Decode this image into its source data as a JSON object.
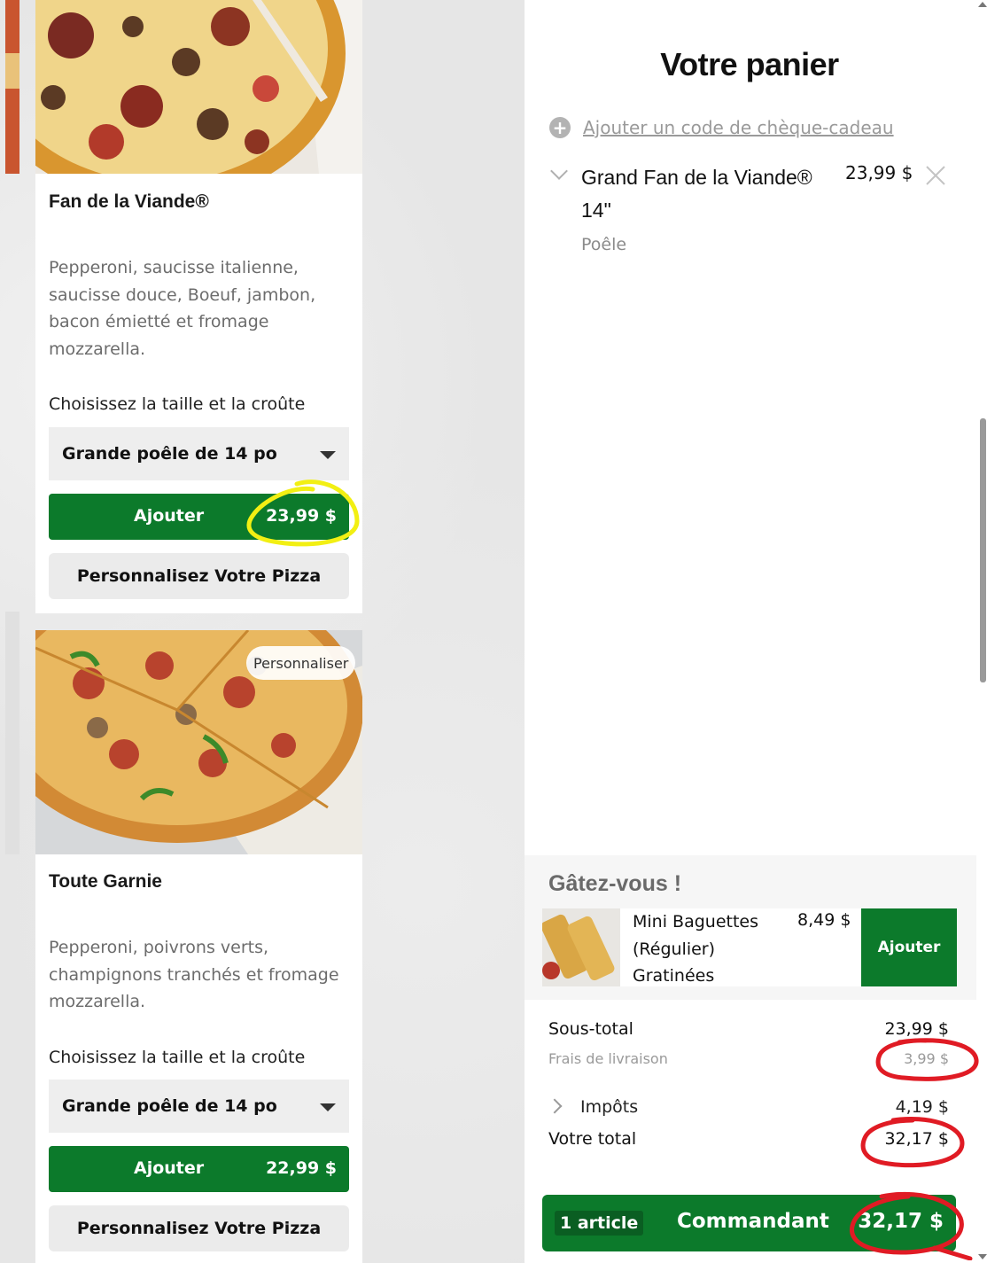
{
  "colors": {
    "brand_green": "#0c7a2b",
    "annotation_yellow": "#f2ef13",
    "annotation_red": "#e01b24"
  },
  "menu": {
    "cards": [
      {
        "title": "Fan de la Viande®",
        "description": "Pepperoni, saucisse italienne, saucisse douce, Boeuf, jambon, bacon émietté et fromage mozzarella.",
        "choose_label": "Choisissez la taille et la croûte",
        "size_selected": "Grande poêle de 14 po",
        "add_label": "Ajouter",
        "add_price": "23,99 $",
        "customize_label": "Personnalisez Votre Pizza"
      },
      {
        "badge": "Personnaliser",
        "title": "Toute Garnie",
        "description": "Pepperoni, poivrons verts, champignons tranchés et fromage mozzarella.",
        "choose_label": "Choisissez la taille et la croûte",
        "size_selected": "Grande poêle de 14 po",
        "add_label": "Ajouter",
        "add_price": "22,99 $",
        "customize_label": "Personnalisez Votre Pizza"
      }
    ]
  },
  "cart": {
    "title": "Votre panier",
    "gift_code_link": "Ajouter un code de chèque-cadeau",
    "item": {
      "name": "Grand Fan de la Viande® 14\"",
      "price": "23,99 $",
      "crust": "Poêle"
    },
    "upsell": {
      "title": "Gâtez-vous !",
      "name": "Mini Baguettes (Régulier) Gratinées",
      "price": "8,49 $",
      "add_label": "Ajouter"
    },
    "summary": {
      "subtotal_label": "Sous-total",
      "subtotal": "23,99 $",
      "delivery_label": "Frais de livraison",
      "delivery": "3,99 $",
      "taxes_label": "Impôts",
      "taxes": "4,19 $",
      "total_label": "Votre total",
      "total": "32,17 $"
    },
    "checkout": {
      "count": "1 article",
      "label": "Commandant",
      "total": "32,17 $"
    }
  }
}
